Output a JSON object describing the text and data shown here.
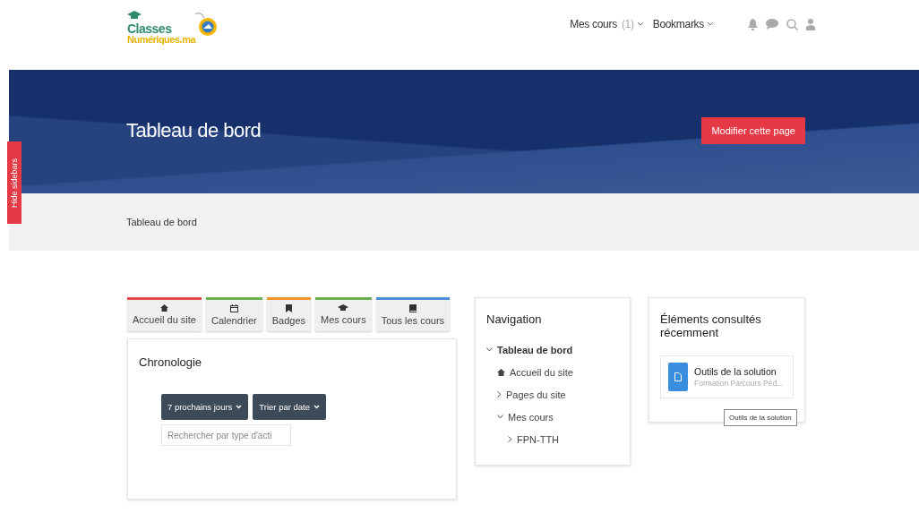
{
  "logo": {
    "line1": "Classes",
    "line2": "Numériques.ma"
  },
  "top_nav": [
    {
      "label": "Mes cours",
      "count": "(1)"
    },
    {
      "label": "Bookmarks"
    }
  ],
  "hide_sidebars": "Hide sidebars",
  "banner": {
    "title": "Tableau de bord",
    "button": "Modifier cette page"
  },
  "breadcrumb": "Tableau de bord",
  "quick_tabs": [
    {
      "label": "Accueil du site",
      "color": "#e5484d"
    },
    {
      "label": "Calendrier",
      "color": "#6ab04c"
    },
    {
      "label": "Badges",
      "color": "#f0932b"
    },
    {
      "label": "Mes cours",
      "color": "#6ab04c"
    },
    {
      "label": "Tous les cours",
      "color": "#4a8fd9"
    }
  ],
  "timeline": {
    "title": "Chronologie",
    "filter": "7 prochains jours",
    "sort": "Trier par date",
    "search_placeholder": "Rechercher par type d'acti"
  },
  "navigation": {
    "title": "Navigation",
    "items": [
      {
        "label": "Tableau de bord",
        "expanded": true,
        "children": [
          {
            "label": "Accueil du site"
          },
          {
            "label": "Pages du site",
            "expanded": false
          },
          {
            "label": "Mes cours",
            "expanded": true,
            "children": [
              {
                "label": "FPN-TTH",
                "expanded": false
              }
            ]
          }
        ]
      }
    ]
  },
  "recent": {
    "title": "Éléments consultés récemment",
    "item": {
      "name": "Outils de la solution",
      "course": "Formation Parcours Péd..."
    },
    "tooltip": "Outils de la solution"
  }
}
